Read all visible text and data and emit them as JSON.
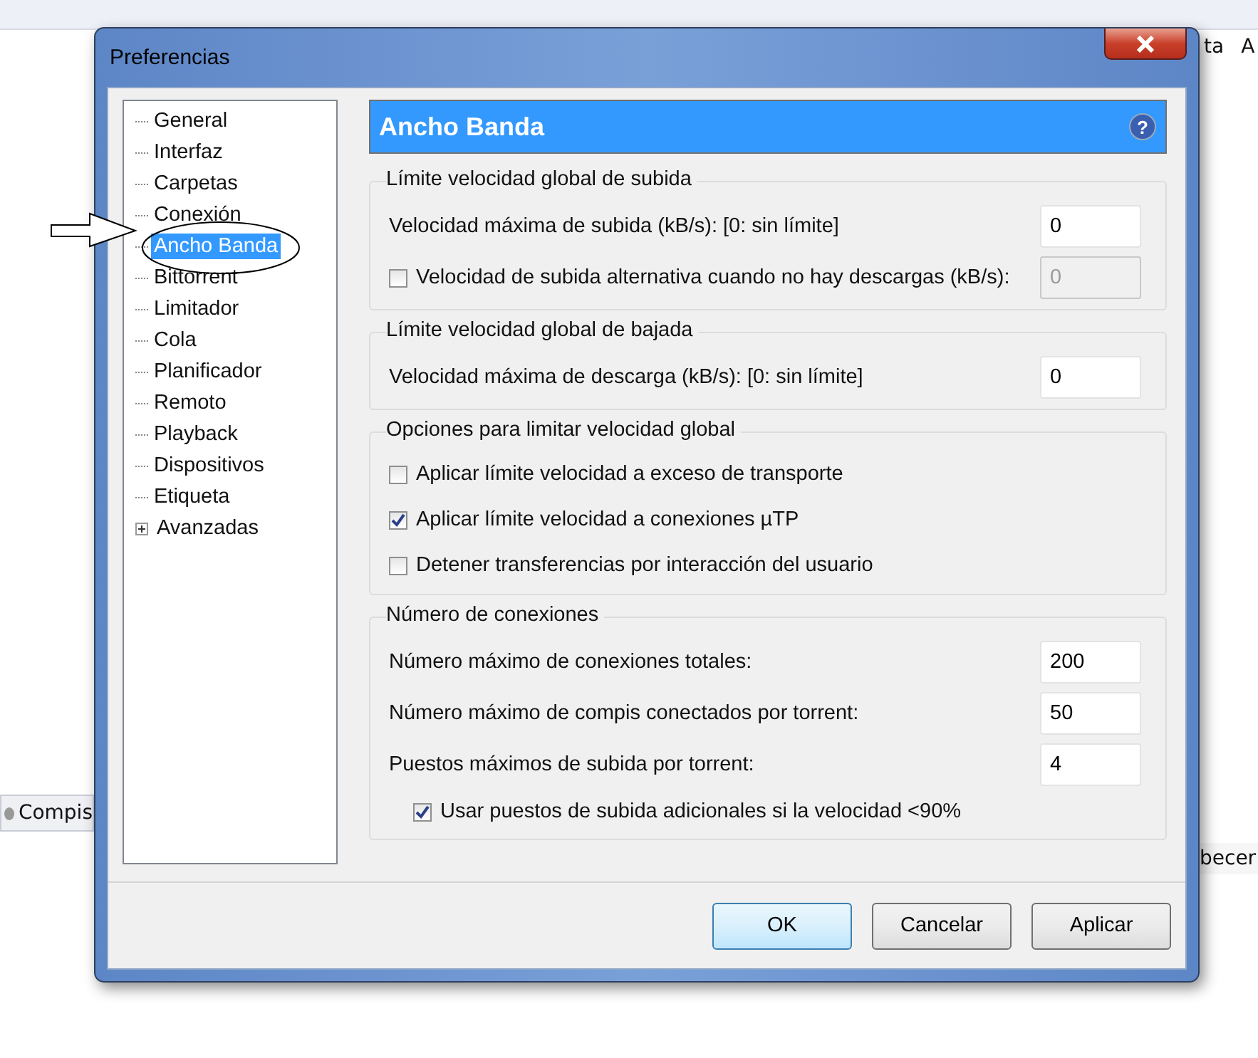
{
  "background": {
    "top_right_texts": [
      "ta",
      "A"
    ],
    "tab": "Compis",
    "column_fragment": "becer"
  },
  "window": {
    "title": "Preferencias"
  },
  "tree": [
    {
      "label": "General",
      "selected": false,
      "expandable": false
    },
    {
      "label": "Interfaz",
      "selected": false,
      "expandable": false
    },
    {
      "label": "Carpetas",
      "selected": false,
      "expandable": false
    },
    {
      "label": "Conexión",
      "selected": false,
      "expandable": false
    },
    {
      "label": "Ancho Banda",
      "selected": true,
      "expandable": false
    },
    {
      "label": "Bittorrent",
      "selected": false,
      "expandable": false
    },
    {
      "label": "Limitador",
      "selected": false,
      "expandable": false
    },
    {
      "label": "Cola",
      "selected": false,
      "expandable": false
    },
    {
      "label": "Planificador",
      "selected": false,
      "expandable": false
    },
    {
      "label": "Remoto",
      "selected": false,
      "expandable": false
    },
    {
      "label": "Playback",
      "selected": false,
      "expandable": false
    },
    {
      "label": "Dispositivos",
      "selected": false,
      "expandable": false
    },
    {
      "label": "Etiqueta",
      "selected": false,
      "expandable": false
    },
    {
      "label": "Avanzadas",
      "selected": false,
      "expandable": true
    }
  ],
  "header": {
    "title": "Ancho Banda",
    "help": "?"
  },
  "groups": [
    {
      "title": "Límite velocidad global de subida",
      "rows": [
        {
          "kind": "field",
          "label": "Velocidad máxima de subida (kB/s): [0: sin límite]",
          "value": "0",
          "disabled": false
        },
        {
          "kind": "checkbox_field",
          "label": "Velocidad de subida alternativa cuando no hay descargas (kB/s):",
          "checked": false,
          "value": "0",
          "disabled": true
        }
      ]
    },
    {
      "title": "Límite velocidad global de bajada",
      "rows": [
        {
          "kind": "field",
          "label": "Velocidad máxima de descarga (kB/s): [0: sin límite]",
          "value": "0",
          "disabled": false
        }
      ]
    },
    {
      "title": "Opciones para limitar velocidad global",
      "rows": [
        {
          "kind": "checkbox",
          "label": "Aplicar límite velocidad a exceso de transporte",
          "checked": false
        },
        {
          "kind": "checkbox",
          "label": "Aplicar límite velocidad a conexiones µTP",
          "checked": true
        },
        {
          "kind": "checkbox",
          "label": "Detener transferencias por interacción del usuario",
          "checked": false
        }
      ]
    },
    {
      "title": "Número de conexiones",
      "rows": [
        {
          "kind": "field",
          "label": "Número máximo de conexiones totales:",
          "value": "200",
          "disabled": false
        },
        {
          "kind": "field",
          "label": "Número máximo de compis conectados por torrent:",
          "value": "50",
          "disabled": false
        },
        {
          "kind": "field",
          "label": "Puestos máximos de subida por torrent:",
          "value": "4",
          "disabled": false
        },
        {
          "kind": "sub_checkbox",
          "label": "Usar puestos de subida adicionales si la velocidad <90%",
          "checked": true
        }
      ]
    }
  ],
  "buttons": [
    {
      "label": "OK",
      "default": true
    },
    {
      "label": "Cancelar",
      "default": false
    },
    {
      "label": "Aplicar",
      "default": false
    }
  ]
}
